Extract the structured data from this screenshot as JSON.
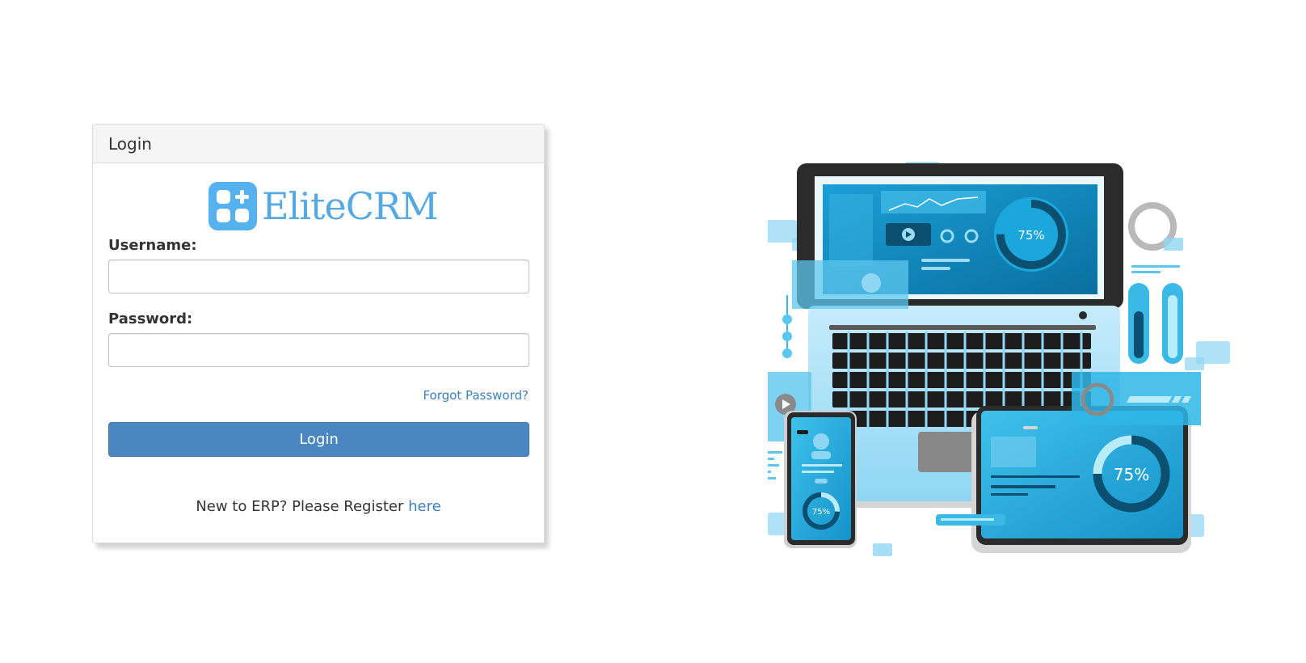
{
  "card": {
    "title": "Login",
    "brand_name": "EliteCRM",
    "username_label": "Username:",
    "username_value": "",
    "password_label": "Password:",
    "password_value": "",
    "forgot_link": "Forgot Password?",
    "login_button": "Login",
    "register_prompt": "New to ERP? Please Register",
    "register_link": "here"
  },
  "illustration": {
    "laptop_screen_percent": "75%",
    "tablet_percent": "75%",
    "phone_percent": "75%"
  },
  "colors": {
    "accent": "#4a87c0",
    "brand": "#55b2ee",
    "link": "#3a7fbf"
  },
  "icons": [
    "app-grid-icon",
    "play-icon",
    "user-icon"
  ]
}
